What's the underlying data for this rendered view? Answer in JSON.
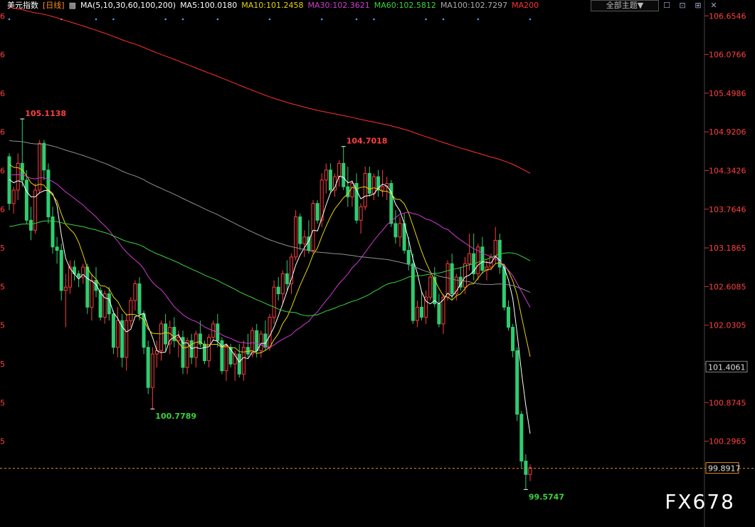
{
  "header": {
    "title": "美元指数",
    "period": "[日线]",
    "ma_label": "MA(5,10,30,60,100,200)",
    "ma5": "MA5:100.0180",
    "ma10": "MA10:101.2458",
    "ma30": "MA30:102.3621",
    "ma60": "MA60:102.5812",
    "ma100": "MA100:102.7297",
    "ma200": "MA200",
    "theme_button": "全部主题▼",
    "tools": [
      "☐",
      "⊡",
      "⊞",
      "✕"
    ]
  },
  "colors": {
    "up": "#ff3b3b",
    "down": "#2ecc71",
    "ma5": "#ffffff",
    "ma10": "#e6d40a",
    "ma30": "#d03cd0",
    "ma60": "#3ad43a",
    "ma100": "#909090",
    "ma200": "#ff3030",
    "axis_text": "#ff4040"
  },
  "chart_data": {
    "type": "candlestick",
    "y_ticks": [
      "106.6546",
      "106.0766",
      "105.4986",
      "104.9206",
      "104.3426",
      "103.7646",
      "103.1865",
      "102.6085",
      "102.0305",
      "101.4525",
      "100.8745",
      "100.2965"
    ],
    "ylim": [
      99.6,
      106.7
    ],
    "markers": {
      "high1": "105.1138",
      "low1": "100.7789",
      "high2": "104.7018",
      "low2": "99.5747"
    },
    "current_price": "99.8917",
    "ma10_tag": "101.4061",
    "ohlc": [
      [
        104.55,
        104.6,
        103.75,
        103.85
      ],
      [
        103.85,
        104.1,
        103.7,
        104.05
      ],
      [
        104.05,
        104.6,
        103.9,
        104.45
      ],
      [
        104.45,
        105.11,
        104.1,
        104.2
      ],
      [
        104.2,
        104.35,
        103.55,
        103.6
      ],
      [
        103.6,
        103.8,
        103.3,
        103.45
      ],
      [
        103.45,
        104.15,
        103.4,
        104.05
      ],
      [
        104.05,
        104.8,
        104.0,
        104.75
      ],
      [
        104.75,
        104.8,
        104.2,
        104.35
      ],
      [
        104.35,
        104.45,
        103.55,
        103.65
      ],
      [
        103.65,
        103.8,
        103.1,
        103.2
      ],
      [
        103.2,
        103.35,
        102.95,
        103.15
      ],
      [
        103.15,
        103.25,
        102.4,
        102.55
      ],
      [
        102.55,
        102.8,
        102.0,
        102.6
      ],
      [
        102.6,
        103.0,
        102.5,
        102.9
      ],
      [
        102.9,
        103.0,
        102.7,
        102.8
      ],
      [
        102.8,
        102.85,
        102.6,
        102.75
      ],
      [
        102.75,
        102.95,
        102.65,
        102.9
      ],
      [
        102.9,
        102.95,
        102.2,
        102.3
      ],
      [
        102.3,
        102.8,
        102.1,
        102.7
      ],
      [
        102.7,
        102.9,
        102.45,
        102.55
      ],
      [
        102.55,
        102.6,
        102.1,
        102.15
      ],
      [
        102.15,
        102.55,
        102.05,
        102.5
      ],
      [
        102.5,
        102.6,
        102.1,
        102.2
      ],
      [
        102.2,
        102.25,
        101.6,
        101.7
      ],
      [
        101.7,
        102.3,
        101.55,
        102.1
      ],
      [
        102.1,
        102.2,
        101.4,
        101.55
      ],
      [
        101.55,
        102.2,
        101.35,
        102.1
      ],
      [
        102.1,
        102.45,
        102.0,
        102.4
      ],
      [
        102.4,
        102.7,
        102.25,
        102.65
      ],
      [
        102.65,
        102.75,
        102.1,
        102.2
      ],
      [
        102.2,
        102.25,
        101.6,
        101.7
      ],
      [
        101.7,
        101.8,
        101.0,
        101.1
      ],
      [
        101.1,
        101.7,
        100.78,
        101.6
      ],
      [
        101.6,
        101.8,
        101.4,
        101.65
      ],
      [
        101.65,
        102.1,
        101.5,
        102.05
      ],
      [
        102.05,
        102.2,
        101.65,
        101.75
      ],
      [
        101.75,
        102.1,
        101.6,
        102.0
      ],
      [
        102.0,
        102.15,
        101.7,
        101.8
      ],
      [
        101.8,
        101.95,
        101.55,
        101.85
      ],
      [
        101.85,
        101.95,
        101.3,
        101.4
      ],
      [
        101.4,
        101.85,
        101.3,
        101.8
      ],
      [
        101.8,
        101.9,
        101.45,
        101.55
      ],
      [
        101.55,
        101.95,
        101.4,
        101.9
      ],
      [
        101.9,
        102.1,
        101.7,
        101.75
      ],
      [
        101.75,
        101.8,
        101.45,
        101.5
      ],
      [
        101.5,
        101.9,
        101.4,
        101.85
      ],
      [
        101.85,
        102.1,
        101.8,
        102.05
      ],
      [
        102.05,
        102.2,
        101.7,
        101.8
      ],
      [
        101.8,
        101.85,
        101.3,
        101.35
      ],
      [
        101.35,
        101.75,
        101.2,
        101.7
      ],
      [
        101.7,
        101.75,
        101.4,
        101.45
      ],
      [
        101.45,
        101.65,
        101.2,
        101.6
      ],
      [
        101.6,
        101.75,
        101.25,
        101.3
      ],
      [
        101.3,
        101.8,
        101.2,
        101.7
      ],
      [
        101.7,
        101.9,
        101.55,
        101.6
      ],
      [
        101.6,
        102.0,
        101.55,
        101.95
      ],
      [
        101.95,
        102.05,
        101.55,
        101.65
      ],
      [
        101.65,
        101.95,
        101.55,
        101.9
      ],
      [
        101.9,
        102.1,
        101.65,
        101.7
      ],
      [
        101.7,
        102.2,
        101.65,
        102.15
      ],
      [
        102.15,
        102.7,
        102.05,
        102.6
      ],
      [
        102.6,
        102.75,
        102.4,
        102.5
      ],
      [
        102.5,
        102.85,
        102.35,
        102.8
      ],
      [
        102.8,
        103.0,
        102.55,
        102.65
      ],
      [
        102.65,
        103.1,
        102.5,
        103.05
      ],
      [
        103.05,
        103.75,
        103.0,
        103.65
      ],
      [
        103.65,
        103.7,
        103.15,
        103.25
      ],
      [
        103.25,
        103.45,
        103.05,
        103.35
      ],
      [
        103.35,
        103.6,
        103.1,
        103.15
      ],
      [
        103.15,
        103.9,
        103.1,
        103.85
      ],
      [
        103.85,
        103.9,
        103.55,
        103.6
      ],
      [
        103.6,
        104.3,
        103.5,
        104.2
      ],
      [
        104.2,
        104.45,
        104.0,
        104.35
      ],
      [
        104.35,
        104.45,
        104.0,
        104.05
      ],
      [
        104.05,
        104.3,
        103.95,
        104.25
      ],
      [
        104.25,
        104.5,
        104.1,
        104.45
      ],
      [
        104.45,
        104.7,
        104.05,
        104.1
      ],
      [
        104.1,
        104.4,
        103.8,
        103.95
      ],
      [
        103.95,
        104.2,
        103.8,
        104.15
      ],
      [
        104.15,
        104.3,
        103.55,
        103.6
      ],
      [
        103.6,
        103.85,
        103.4,
        103.8
      ],
      [
        103.8,
        104.4,
        103.75,
        104.3
      ],
      [
        104.3,
        104.4,
        103.95,
        104.0
      ],
      [
        104.0,
        104.3,
        103.9,
        104.25
      ],
      [
        104.25,
        104.35,
        103.95,
        104.05
      ],
      [
        104.05,
        104.35,
        103.95,
        104.1
      ],
      [
        104.1,
        104.25,
        103.9,
        104.15
      ],
      [
        104.15,
        104.2,
        103.5,
        103.55
      ],
      [
        103.55,
        103.75,
        103.25,
        103.35
      ],
      [
        103.35,
        103.65,
        103.2,
        103.55
      ],
      [
        103.55,
        103.7,
        103.1,
        103.15
      ],
      [
        103.15,
        103.35,
        102.85,
        102.95
      ],
      [
        102.95,
        103.1,
        102.05,
        102.1
      ],
      [
        102.1,
        102.4,
        102.0,
        102.3
      ],
      [
        102.3,
        102.55,
        102.1,
        102.15
      ],
      [
        102.15,
        102.55,
        102.05,
        102.45
      ],
      [
        102.45,
        102.8,
        102.4,
        102.75
      ],
      [
        102.75,
        102.9,
        102.3,
        102.35
      ],
      [
        102.35,
        102.5,
        102.0,
        102.05
      ],
      [
        102.05,
        102.5,
        101.9,
        102.45
      ],
      [
        102.45,
        103.0,
        102.4,
        102.95
      ],
      [
        102.95,
        103.1,
        102.4,
        102.5
      ],
      [
        102.5,
        102.8,
        102.4,
        102.75
      ],
      [
        102.75,
        102.9,
        102.55,
        102.6
      ],
      [
        102.6,
        103.05,
        102.5,
        102.95
      ],
      [
        102.95,
        103.4,
        102.85,
        103.1
      ],
      [
        103.1,
        103.4,
        102.7,
        102.8
      ],
      [
        102.8,
        103.25,
        102.7,
        103.2
      ],
      [
        103.2,
        103.35,
        102.8,
        102.85
      ],
      [
        102.85,
        103.0,
        102.7,
        102.9
      ],
      [
        102.9,
        103.1,
        102.85,
        103.05
      ],
      [
        103.05,
        103.5,
        102.95,
        103.3
      ],
      [
        103.3,
        103.4,
        102.8,
        102.9
      ],
      [
        102.9,
        102.95,
        102.25,
        102.3
      ],
      [
        102.3,
        102.4,
        101.95,
        102.0
      ],
      [
        102.0,
        102.05,
        101.55,
        101.65
      ],
      [
        101.65,
        101.7,
        100.6,
        100.7
      ],
      [
        100.7,
        100.75,
        99.9,
        100.0
      ],
      [
        100.0,
        100.1,
        99.58,
        99.8
      ],
      [
        99.8,
        99.95,
        99.7,
        99.9
      ]
    ]
  }
}
